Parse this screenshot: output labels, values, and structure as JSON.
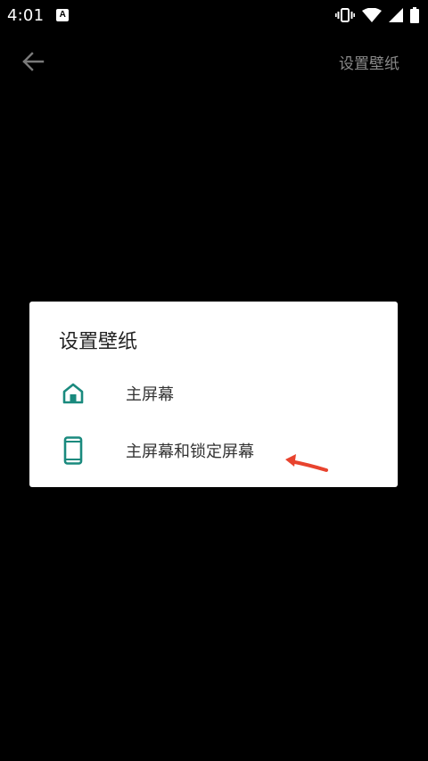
{
  "status_bar": {
    "time": "4:01",
    "notification_icon_letter": "A"
  },
  "app_bar": {
    "back_icon": "arrow-back-icon",
    "title": "设置壁纸"
  },
  "dialog": {
    "title": "设置壁纸",
    "options": [
      {
        "label": "主屏幕",
        "icon": "home-icon"
      },
      {
        "label": "主屏幕和锁定屏幕",
        "icon": "phone-icon"
      }
    ]
  },
  "colors": {
    "background": "#000000",
    "accent": "#1a8a7e",
    "annotation": "#e8432e"
  }
}
